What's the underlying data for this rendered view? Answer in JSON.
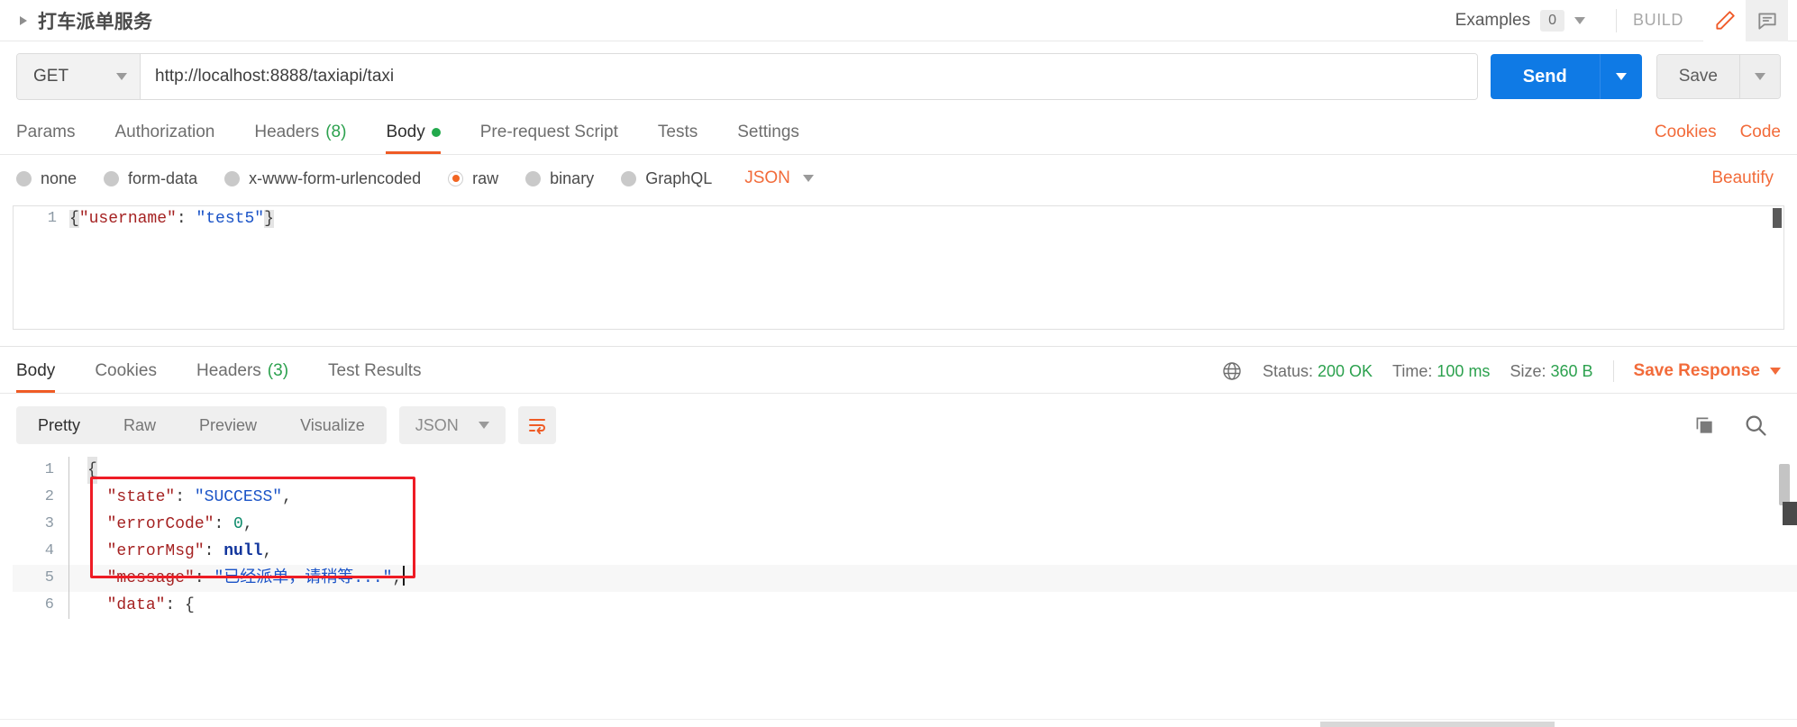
{
  "header": {
    "title": "打车派单服务",
    "collapse_icon": "triangle-right-icon",
    "examples_label": "Examples",
    "examples_count": "0",
    "build_label": "BUILD",
    "edit_icon": "pencil-icon",
    "comment_icon": "comment-icon"
  },
  "url_bar": {
    "method": "GET",
    "url": "http://localhost:8888/taxiapi/taxi",
    "send_label": "Send",
    "save_label": "Save"
  },
  "request_tabs": {
    "items": [
      {
        "label": "Params",
        "count": "",
        "active": false
      },
      {
        "label": "Authorization",
        "count": "",
        "active": false
      },
      {
        "label": "Headers",
        "count": "(8)",
        "active": false
      },
      {
        "label": "Body",
        "count": "",
        "active": true
      },
      {
        "label": "Pre-request Script",
        "count": "",
        "active": false
      },
      {
        "label": "Tests",
        "count": "",
        "active": false
      },
      {
        "label": "Settings",
        "count": "",
        "active": false
      }
    ],
    "cookies_link": "Cookies",
    "code_link": "Code"
  },
  "body_type": {
    "options": [
      {
        "label": "none",
        "selected": false
      },
      {
        "label": "form-data",
        "selected": false
      },
      {
        "label": "x-www-form-urlencoded",
        "selected": false
      },
      {
        "label": "raw",
        "selected": true
      },
      {
        "label": "binary",
        "selected": false
      },
      {
        "label": "GraphQL",
        "selected": false
      }
    ],
    "format": "JSON",
    "beautify_label": "Beautify"
  },
  "request_body": {
    "line_number": "1",
    "open_brace": "{",
    "key": "\"username\"",
    "colon": ": ",
    "value": "\"test5\"",
    "close_brace": "}"
  },
  "response_tabs": {
    "items": [
      {
        "label": "Body",
        "count": "",
        "active": true
      },
      {
        "label": "Cookies",
        "count": "",
        "active": false
      },
      {
        "label": "Headers",
        "count": "(3)",
        "active": false
      },
      {
        "label": "Test Results",
        "count": "",
        "active": false
      }
    ],
    "globe_icon": "globe-icon",
    "status_label": "Status:",
    "status_value": "200 OK",
    "time_label": "Time:",
    "time_value": "100 ms",
    "size_label": "Size:",
    "size_value": "360 B",
    "save_response_label": "Save Response"
  },
  "response_toolbar": {
    "views": [
      {
        "label": "Pretty",
        "active": true
      },
      {
        "label": "Raw",
        "active": false
      },
      {
        "label": "Preview",
        "active": false
      },
      {
        "label": "Visualize",
        "active": false
      }
    ],
    "format": "JSON",
    "wrap_icon": "word-wrap-icon",
    "copy_icon": "copy-icon",
    "search_icon": "search-icon"
  },
  "response_body": {
    "lines": [
      {
        "n": "1",
        "open": "{",
        "key": "",
        "colon": "",
        "value": "",
        "trail": "",
        "highlight": false
      },
      {
        "n": "2",
        "open": "",
        "key": "\"state\"",
        "colon": ": ",
        "value": "\"SUCCESS\"",
        "vtype": "str",
        "trail": ",",
        "highlight": false
      },
      {
        "n": "3",
        "open": "",
        "key": "\"errorCode\"",
        "colon": ": ",
        "value": "0",
        "vtype": "num",
        "trail": ",",
        "highlight": false
      },
      {
        "n": "4",
        "open": "",
        "key": "\"errorMsg\"",
        "colon": ": ",
        "value": "null",
        "vtype": "null",
        "trail": ",",
        "highlight": false
      },
      {
        "n": "5",
        "open": "",
        "key": "\"message\"",
        "colon": ": ",
        "value": "\"已经派单，请稍等...\"",
        "vtype": "str",
        "trail": ",",
        "highlight": true
      },
      {
        "n": "6",
        "open": "",
        "key": "\"data\"",
        "colon": ": ",
        "value": "{",
        "vtype": "punc",
        "trail": "",
        "highlight": false
      }
    ],
    "annotation": "red-highlight-box"
  },
  "colors": {
    "accent_orange": "#f26b3a",
    "send_blue": "#0f7ae5",
    "status_green": "#2ca14e",
    "annotation_red": "#ee1c25"
  }
}
